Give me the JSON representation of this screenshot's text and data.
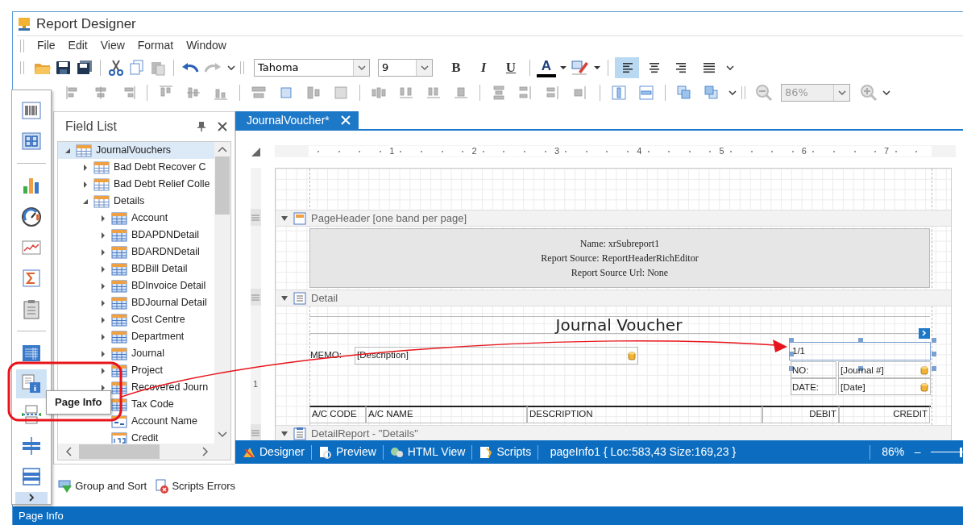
{
  "window": {
    "title": "Report Designer"
  },
  "menu": [
    "File",
    "Edit",
    "View",
    "Format",
    "Window"
  ],
  "format_toolbar": {
    "font": "Tahoma",
    "size": "9",
    "bold": "B",
    "italic": "I",
    "underline": "U",
    "font_color": "A",
    "alignment": [
      {
        "kind": "left",
        "selected": true
      },
      {
        "kind": "center",
        "selected": false
      },
      {
        "kind": "right",
        "selected": false
      },
      {
        "kind": "justify",
        "selected": false
      }
    ]
  },
  "layout_toolbar": {
    "zoom": "86%"
  },
  "toolbox": [
    {
      "kind": "barcode",
      "selected": false
    },
    {
      "kind": "digits",
      "selected": false
    },
    {
      "kind": "separator"
    },
    {
      "kind": "chart",
      "selected": false
    },
    {
      "kind": "gauge",
      "selected": false
    },
    {
      "kind": "sparkline",
      "selected": false
    },
    {
      "kind": "sum",
      "selected": false
    },
    {
      "kind": "clipboard",
      "selected": false
    },
    {
      "kind": "separator"
    },
    {
      "kind": "table",
      "selected": false
    },
    {
      "kind": "pageinfo",
      "selected": true
    },
    {
      "kind": "pagebreak",
      "selected": false
    },
    {
      "kind": "crossline",
      "selected": false
    },
    {
      "kind": "crossbox",
      "selected": false
    }
  ],
  "tooltip": "Page Info",
  "field_list": {
    "title": "Field List",
    "tree": [
      {
        "label": "JournalVouchers",
        "kind": "table",
        "expanded": true,
        "selected": true,
        "children": [
          {
            "label": "Bad Debt Recover C",
            "kind": "table",
            "expanded": false,
            "selected": false
          },
          {
            "label": "Bad Debt Relief Colle",
            "kind": "table",
            "expanded": false,
            "selected": false
          },
          {
            "label": "Details",
            "kind": "table",
            "expanded": true,
            "selected": false,
            "children": [
              {
                "label": "Account",
                "kind": "table",
                "expanded": false,
                "selected": false
              },
              {
                "label": "BDAPDNDetail",
                "kind": "table",
                "expanded": false,
                "selected": false
              },
              {
                "label": "BDARDNDetail",
                "kind": "table",
                "expanded": false,
                "selected": false
              },
              {
                "label": "BDBill Detail",
                "kind": "table",
                "expanded": false,
                "selected": false
              },
              {
                "label": "BDInvoice Detail",
                "kind": "table",
                "expanded": false,
                "selected": false
              },
              {
                "label": "BDJournal Detail",
                "kind": "table",
                "expanded": false,
                "selected": false
              },
              {
                "label": "Cost Centre",
                "kind": "table",
                "expanded": false,
                "selected": false
              },
              {
                "label": "Department",
                "kind": "table",
                "expanded": false,
                "selected": false
              },
              {
                "label": "Journal",
                "kind": "table",
                "expanded": false,
                "selected": false
              },
              {
                "label": "Project",
                "kind": "table",
                "expanded": false,
                "selected": false
              },
              {
                "label": "Recovered Journ",
                "kind": "table",
                "expanded": false,
                "selected": false
              },
              {
                "label": "Tax Code",
                "kind": "table",
                "selected": false
              },
              {
                "label": "Account Name",
                "kind": "text",
                "selected": false
              },
              {
                "label": "Credit",
                "kind": "number",
                "selected": false
              }
            ]
          }
        ]
      }
    ]
  },
  "dock_tabs": [
    "Group and Sort",
    "Scripts Errors"
  ],
  "document_tab": {
    "label": "JournalVoucher*"
  },
  "ruler": [
    "1",
    "2",
    "3",
    "4",
    "5",
    "6",
    "7"
  ],
  "vertical_ruler": [
    "1"
  ],
  "bands": [
    {
      "label": "PageHeader [one band per page]",
      "kind": "pageheader",
      "expanded": true
    },
    {
      "label": "Detail",
      "kind": "detail",
      "expanded": true
    },
    {
      "label": "DetailReport - \"Details\"",
      "kind": "detailreport",
      "expanded": true
    }
  ],
  "subreport": [
    "Name: xrSubreport1",
    "Report Source: ReportHeaderRichEditor",
    "Report Source Url: None"
  ],
  "report": {
    "title": "Journal Voucher",
    "memo_label": "MEMO:",
    "memo_value": "[Description]",
    "page_info": "1/1",
    "no_label": "NO:",
    "no_value": "[Journal #]",
    "date_label": "DATE:",
    "date_value": "[Date]",
    "columns": [
      "A/C CODE",
      "A/C NAME",
      "DESCRIPTION",
      "DEBIT",
      "CREDIT"
    ]
  },
  "views": [
    {
      "label": "Designer",
      "kind": "designer"
    },
    {
      "label": "Preview",
      "kind": "preview"
    },
    {
      "label": "HTML View",
      "kind": "html"
    },
    {
      "label": "Scripts",
      "kind": "scripts"
    }
  ],
  "selection_info": "pageInfo1 { Loc:583,43 Size:169,23 }",
  "zoom": {
    "reading": "86%",
    "minus": "–",
    "level": 0.95
  },
  "status_bar": "Page Info"
}
